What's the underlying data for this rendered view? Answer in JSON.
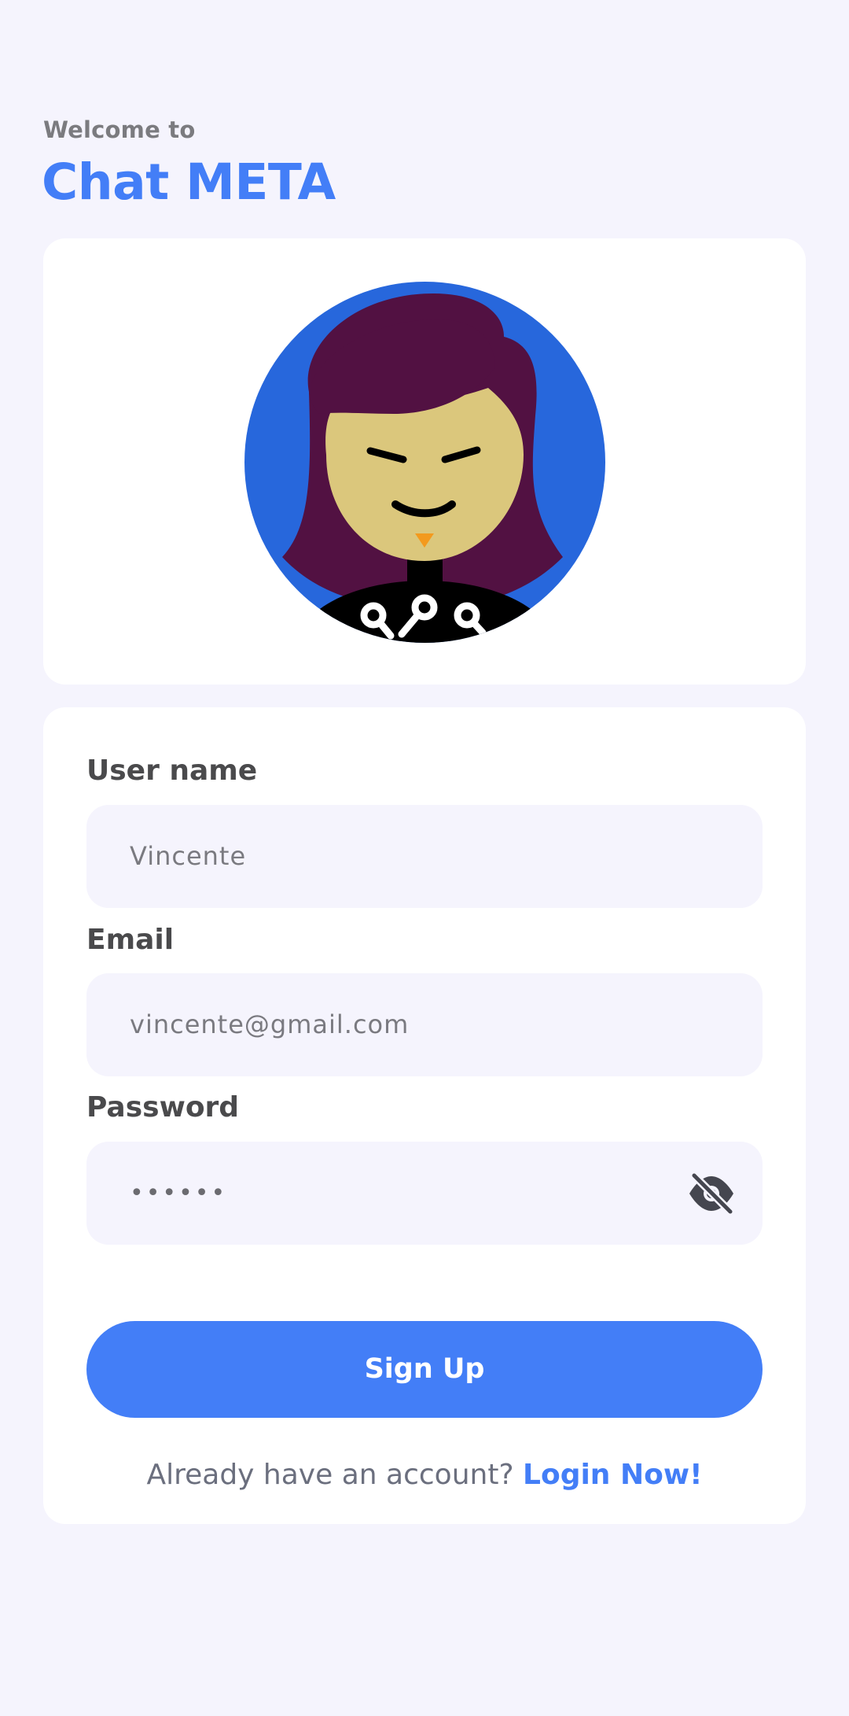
{
  "header": {
    "welcome": "Welcome to",
    "title": "Chat META"
  },
  "avatar": {
    "icon": "avatar-girl-illustration"
  },
  "form": {
    "username": {
      "label": "User name",
      "value": "Vincente"
    },
    "email": {
      "label": "Email",
      "value": "vincente@gmail.com"
    },
    "password": {
      "label": "Password",
      "value": "••••••",
      "toggle_icon": "eye-off-icon"
    },
    "signup_label": "Sign Up",
    "footer_text": "Already have an account?",
    "login_label": "Login Now!"
  },
  "colors": {
    "background": "#f5f4fd",
    "accent": "#437ef7",
    "card": "#ffffff",
    "field": "#f5f4fd"
  }
}
